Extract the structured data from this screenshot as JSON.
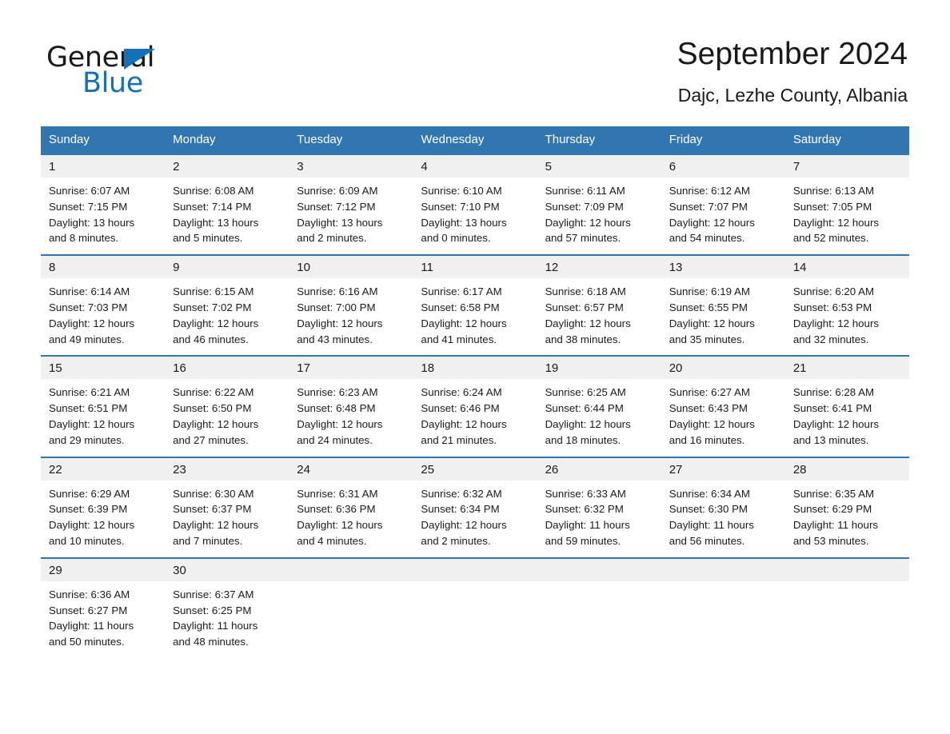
{
  "brand": {
    "logo_text_1": "General",
    "logo_text_2": "Blue",
    "logo_triangle_color": "#1570b8",
    "accent_color": "#3276b1"
  },
  "header": {
    "title": "September 2024",
    "subtitle": "Dajc, Lezhe County, Albania"
  },
  "weekdays": [
    "Sunday",
    "Monday",
    "Tuesday",
    "Wednesday",
    "Thursday",
    "Friday",
    "Saturday"
  ],
  "labels": {
    "sunrise_prefix": "Sunrise:",
    "sunset_prefix": "Sunset:",
    "daylight_prefix": "Daylight:"
  },
  "weeks": [
    [
      {
        "day": "1",
        "sunrise": "Sunrise: 6:07 AM",
        "sunset": "Sunset: 7:15 PM",
        "daylight_1": "Daylight: 13 hours",
        "daylight_2": "and 8 minutes."
      },
      {
        "day": "2",
        "sunrise": "Sunrise: 6:08 AM",
        "sunset": "Sunset: 7:14 PM",
        "daylight_1": "Daylight: 13 hours",
        "daylight_2": "and 5 minutes."
      },
      {
        "day": "3",
        "sunrise": "Sunrise: 6:09 AM",
        "sunset": "Sunset: 7:12 PM",
        "daylight_1": "Daylight: 13 hours",
        "daylight_2": "and 2 minutes."
      },
      {
        "day": "4",
        "sunrise": "Sunrise: 6:10 AM",
        "sunset": "Sunset: 7:10 PM",
        "daylight_1": "Daylight: 13 hours",
        "daylight_2": "and 0 minutes."
      },
      {
        "day": "5",
        "sunrise": "Sunrise: 6:11 AM",
        "sunset": "Sunset: 7:09 PM",
        "daylight_1": "Daylight: 12 hours",
        "daylight_2": "and 57 minutes."
      },
      {
        "day": "6",
        "sunrise": "Sunrise: 6:12 AM",
        "sunset": "Sunset: 7:07 PM",
        "daylight_1": "Daylight: 12 hours",
        "daylight_2": "and 54 minutes."
      },
      {
        "day": "7",
        "sunrise": "Sunrise: 6:13 AM",
        "sunset": "Sunset: 7:05 PM",
        "daylight_1": "Daylight: 12 hours",
        "daylight_2": "and 52 minutes."
      }
    ],
    [
      {
        "day": "8",
        "sunrise": "Sunrise: 6:14 AM",
        "sunset": "Sunset: 7:03 PM",
        "daylight_1": "Daylight: 12 hours",
        "daylight_2": "and 49 minutes."
      },
      {
        "day": "9",
        "sunrise": "Sunrise: 6:15 AM",
        "sunset": "Sunset: 7:02 PM",
        "daylight_1": "Daylight: 12 hours",
        "daylight_2": "and 46 minutes."
      },
      {
        "day": "10",
        "sunrise": "Sunrise: 6:16 AM",
        "sunset": "Sunset: 7:00 PM",
        "daylight_1": "Daylight: 12 hours",
        "daylight_2": "and 43 minutes."
      },
      {
        "day": "11",
        "sunrise": "Sunrise: 6:17 AM",
        "sunset": "Sunset: 6:58 PM",
        "daylight_1": "Daylight: 12 hours",
        "daylight_2": "and 41 minutes."
      },
      {
        "day": "12",
        "sunrise": "Sunrise: 6:18 AM",
        "sunset": "Sunset: 6:57 PM",
        "daylight_1": "Daylight: 12 hours",
        "daylight_2": "and 38 minutes."
      },
      {
        "day": "13",
        "sunrise": "Sunrise: 6:19 AM",
        "sunset": "Sunset: 6:55 PM",
        "daylight_1": "Daylight: 12 hours",
        "daylight_2": "and 35 minutes."
      },
      {
        "day": "14",
        "sunrise": "Sunrise: 6:20 AM",
        "sunset": "Sunset: 6:53 PM",
        "daylight_1": "Daylight: 12 hours",
        "daylight_2": "and 32 minutes."
      }
    ],
    [
      {
        "day": "15",
        "sunrise": "Sunrise: 6:21 AM",
        "sunset": "Sunset: 6:51 PM",
        "daylight_1": "Daylight: 12 hours",
        "daylight_2": "and 29 minutes."
      },
      {
        "day": "16",
        "sunrise": "Sunrise: 6:22 AM",
        "sunset": "Sunset: 6:50 PM",
        "daylight_1": "Daylight: 12 hours",
        "daylight_2": "and 27 minutes."
      },
      {
        "day": "17",
        "sunrise": "Sunrise: 6:23 AM",
        "sunset": "Sunset: 6:48 PM",
        "daylight_1": "Daylight: 12 hours",
        "daylight_2": "and 24 minutes."
      },
      {
        "day": "18",
        "sunrise": "Sunrise: 6:24 AM",
        "sunset": "Sunset: 6:46 PM",
        "daylight_1": "Daylight: 12 hours",
        "daylight_2": "and 21 minutes."
      },
      {
        "day": "19",
        "sunrise": "Sunrise: 6:25 AM",
        "sunset": "Sunset: 6:44 PM",
        "daylight_1": "Daylight: 12 hours",
        "daylight_2": "and 18 minutes."
      },
      {
        "day": "20",
        "sunrise": "Sunrise: 6:27 AM",
        "sunset": "Sunset: 6:43 PM",
        "daylight_1": "Daylight: 12 hours",
        "daylight_2": "and 16 minutes."
      },
      {
        "day": "21",
        "sunrise": "Sunrise: 6:28 AM",
        "sunset": "Sunset: 6:41 PM",
        "daylight_1": "Daylight: 12 hours",
        "daylight_2": "and 13 minutes."
      }
    ],
    [
      {
        "day": "22",
        "sunrise": "Sunrise: 6:29 AM",
        "sunset": "Sunset: 6:39 PM",
        "daylight_1": "Daylight: 12 hours",
        "daylight_2": "and 10 minutes."
      },
      {
        "day": "23",
        "sunrise": "Sunrise: 6:30 AM",
        "sunset": "Sunset: 6:37 PM",
        "daylight_1": "Daylight: 12 hours",
        "daylight_2": "and 7 minutes."
      },
      {
        "day": "24",
        "sunrise": "Sunrise: 6:31 AM",
        "sunset": "Sunset: 6:36 PM",
        "daylight_1": "Daylight: 12 hours",
        "daylight_2": "and 4 minutes."
      },
      {
        "day": "25",
        "sunrise": "Sunrise: 6:32 AM",
        "sunset": "Sunset: 6:34 PM",
        "daylight_1": "Daylight: 12 hours",
        "daylight_2": "and 2 minutes."
      },
      {
        "day": "26",
        "sunrise": "Sunrise: 6:33 AM",
        "sunset": "Sunset: 6:32 PM",
        "daylight_1": "Daylight: 11 hours",
        "daylight_2": "and 59 minutes."
      },
      {
        "day": "27",
        "sunrise": "Sunrise: 6:34 AM",
        "sunset": "Sunset: 6:30 PM",
        "daylight_1": "Daylight: 11 hours",
        "daylight_2": "and 56 minutes."
      },
      {
        "day": "28",
        "sunrise": "Sunrise: 6:35 AM",
        "sunset": "Sunset: 6:29 PM",
        "daylight_1": "Daylight: 11 hours",
        "daylight_2": "and 53 minutes."
      }
    ],
    [
      {
        "day": "29",
        "sunrise": "Sunrise: 6:36 AM",
        "sunset": "Sunset: 6:27 PM",
        "daylight_1": "Daylight: 11 hours",
        "daylight_2": "and 50 minutes."
      },
      {
        "day": "30",
        "sunrise": "Sunrise: 6:37 AM",
        "sunset": "Sunset: 6:25 PM",
        "daylight_1": "Daylight: 11 hours",
        "daylight_2": "and 48 minutes."
      },
      {
        "day": "",
        "sunrise": "",
        "sunset": "",
        "daylight_1": "",
        "daylight_2": ""
      },
      {
        "day": "",
        "sunrise": "",
        "sunset": "",
        "daylight_1": "",
        "daylight_2": ""
      },
      {
        "day": "",
        "sunrise": "",
        "sunset": "",
        "daylight_1": "",
        "daylight_2": ""
      },
      {
        "day": "",
        "sunrise": "",
        "sunset": "",
        "daylight_1": "",
        "daylight_2": ""
      },
      {
        "day": "",
        "sunrise": "",
        "sunset": "",
        "daylight_1": "",
        "daylight_2": ""
      }
    ]
  ]
}
